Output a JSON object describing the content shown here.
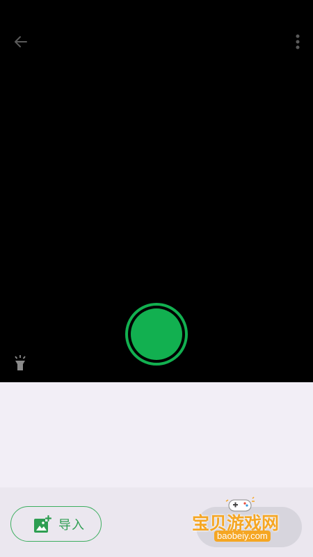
{
  "camera": {
    "back_icon": "arrow-left-icon",
    "more_icon": "more-vertical-icon",
    "torch_icon": "flashlight-icon",
    "shutter_color": "#12b050"
  },
  "bottom": {
    "import_label": "导入",
    "import_icon": "add-image-icon",
    "accent": "#2e9e52"
  },
  "watermark": {
    "text": "宝贝游戏网",
    "domain": "baobeiy.com"
  }
}
